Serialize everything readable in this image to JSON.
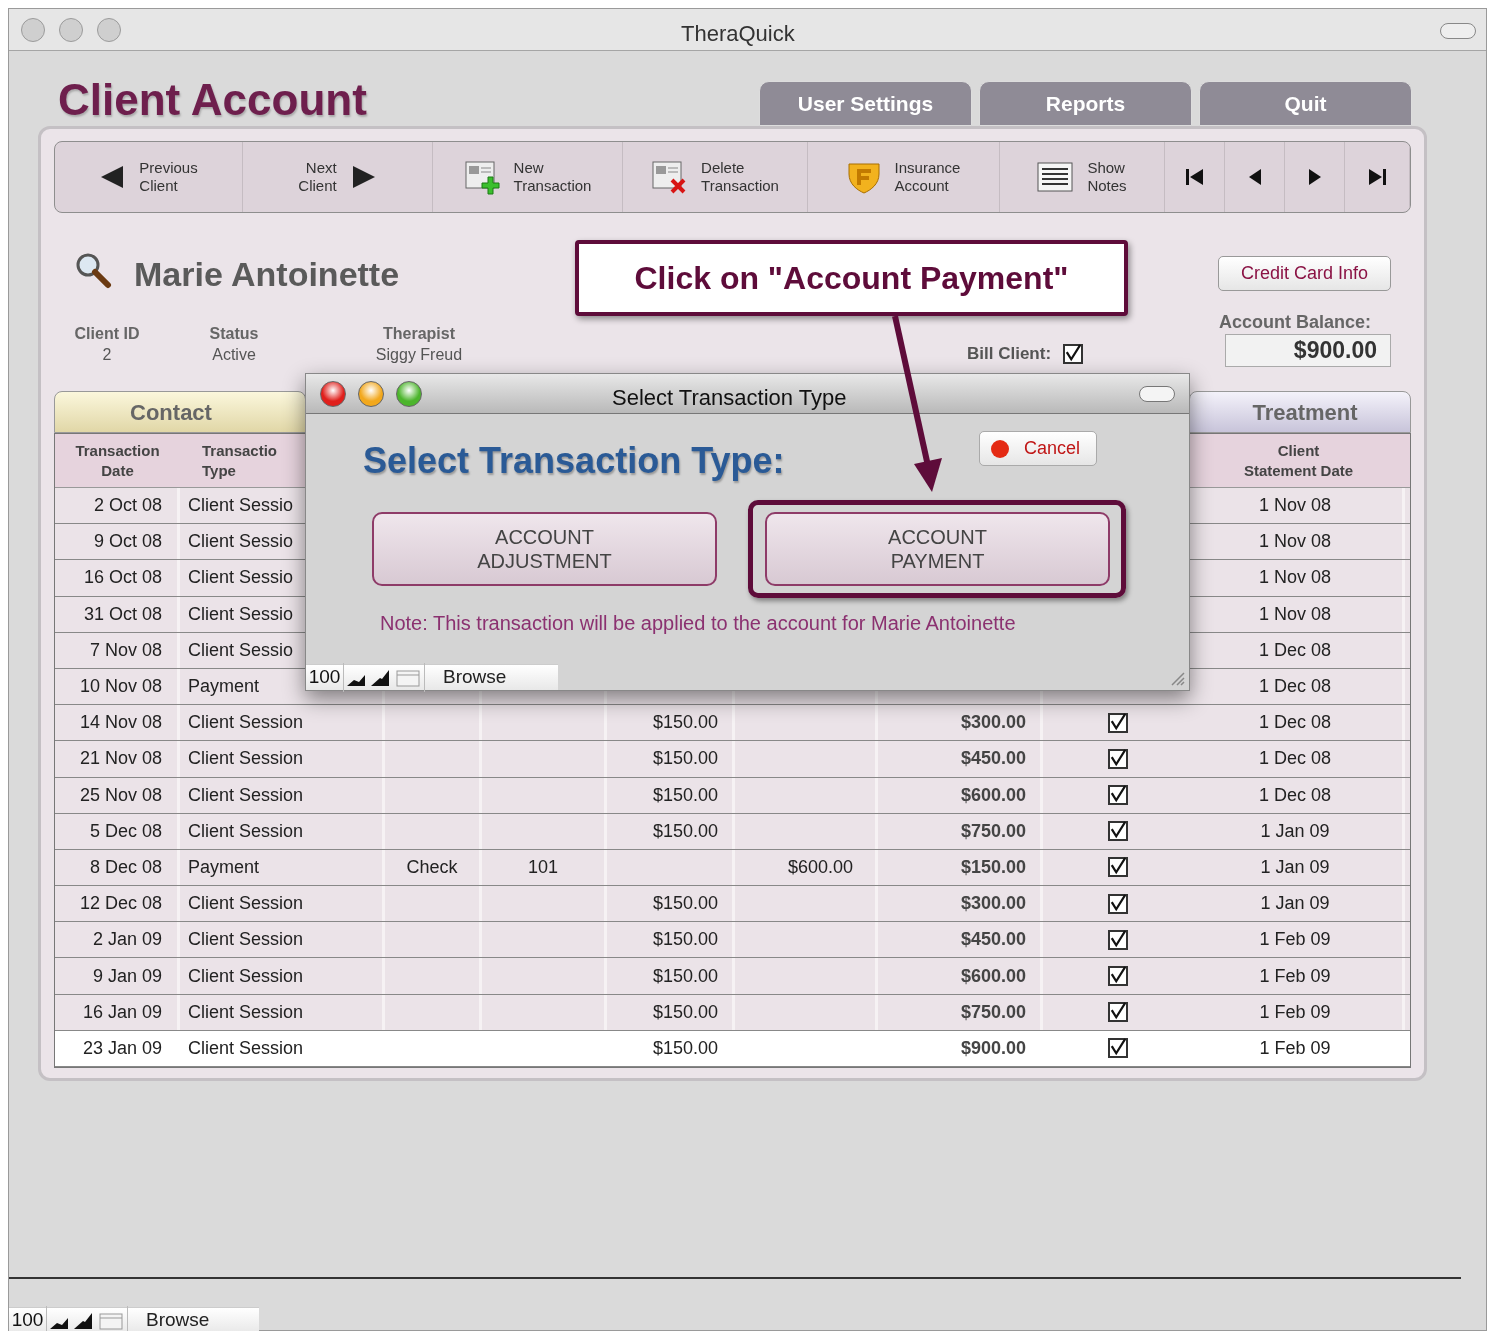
{
  "window": {
    "title": "TheraQuick"
  },
  "page_title": "Client Account",
  "top_tabs": [
    {
      "label": "User Settings"
    },
    {
      "label": "Reports"
    },
    {
      "label": "Quit"
    }
  ],
  "toolbar": [
    {
      "kind": "prev_client",
      "lines": [
        "Previous",
        "Client"
      ]
    },
    {
      "kind": "next_client",
      "lines": [
        "Next",
        "Client"
      ]
    },
    {
      "kind": "new",
      "lines": [
        "New",
        "Transaction"
      ]
    },
    {
      "kind": "delete",
      "lines": [
        "Delete",
        "Transaction"
      ]
    },
    {
      "kind": "insurance",
      "lines": [
        "Insurance",
        "Account"
      ]
    },
    {
      "kind": "notes",
      "lines": [
        "Show",
        "Notes"
      ]
    },
    {
      "kind": "first"
    },
    {
      "kind": "back"
    },
    {
      "kind": "forward"
    },
    {
      "kind": "last"
    }
  ],
  "client": {
    "name": "Marie Antoinette",
    "fields": [
      {
        "label": "Client ID",
        "value": "2"
      },
      {
        "label": "Status",
        "value": "Active"
      },
      {
        "label": "Therapist",
        "value": "Siggy Freud"
      }
    ],
    "bill_client": {
      "label": "Bill Client:",
      "checked": true
    },
    "credit_card_button": "Credit Card Info",
    "balance": {
      "label": "Account Balance:",
      "value": "$900.00"
    }
  },
  "section_tabs": [
    {
      "label": "Contact",
      "kind": "contact"
    },
    {
      "label": "Treatment",
      "kind": "treatment"
    }
  ],
  "table": {
    "header": {
      "date": [
        "Transaction",
        "Date"
      ],
      "type": [
        "Transactio",
        "Type"
      ],
      "statement": [
        "Client",
        "Statement Date"
      ]
    },
    "rows": [
      {
        "date": "2 Oct 08",
        "type": "Client Sessio",
        "statement": "1 Nov 08",
        "selected": false
      },
      {
        "date": "9 Oct 08",
        "type": "Client Sessio",
        "statement": "1 Nov 08",
        "selected": false
      },
      {
        "date": "16 Oct 08",
        "type": "Client Sessio",
        "statement": "1 Nov 08",
        "selected": false
      },
      {
        "date": "31 Oct 08",
        "type": "Client Sessio",
        "statement": "1 Nov 08",
        "selected": false
      },
      {
        "date": "7 Nov 08",
        "type": "Client Sessio",
        "statement": "1 Dec 08",
        "selected": false
      },
      {
        "date": "10 Nov 08",
        "type": "Payment",
        "statement": "1 Dec 08",
        "selected": false
      },
      {
        "date": "14 Nov 08",
        "type": "Client Session",
        "charge": "$150.00",
        "balance": "$300.00",
        "billed": true,
        "statement": "1 Dec 08",
        "selected": false
      },
      {
        "date": "21 Nov 08",
        "type": "Client Session",
        "charge": "$150.00",
        "balance": "$450.00",
        "billed": true,
        "statement": "1 Dec 08",
        "selected": false
      },
      {
        "date": "25 Nov 08",
        "type": "Client Session",
        "charge": "$150.00",
        "balance": "$600.00",
        "billed": true,
        "statement": "1 Dec 08",
        "selected": false
      },
      {
        "date": "5 Dec 08",
        "type": "Client Session",
        "charge": "$150.00",
        "balance": "$750.00",
        "billed": true,
        "statement": "1 Jan 09",
        "selected": false
      },
      {
        "date": "8 Dec 08",
        "type": "Payment",
        "method": "Check",
        "ref": "101",
        "payment": "$600.00",
        "balance": "$150.00",
        "billed": true,
        "statement": "1 Jan 09",
        "selected": false
      },
      {
        "date": "12 Dec 08",
        "type": "Client Session",
        "charge": "$150.00",
        "balance": "$300.00",
        "billed": true,
        "statement": "1 Jan 09",
        "selected": false
      },
      {
        "date": "2 Jan 09",
        "type": "Client Session",
        "charge": "$150.00",
        "balance": "$450.00",
        "billed": true,
        "statement": "1 Feb 09",
        "selected": false
      },
      {
        "date": "9 Jan 09",
        "type": "Client Session",
        "charge": "$150.00",
        "balance": "$600.00",
        "billed": true,
        "statement": "1 Feb 09",
        "selected": false
      },
      {
        "date": "16 Jan 09",
        "type": "Client Session",
        "charge": "$150.00",
        "balance": "$750.00",
        "billed": true,
        "statement": "1 Feb 09",
        "selected": false
      },
      {
        "date": "23 Jan 09",
        "type": "Client Session",
        "charge": "$150.00",
        "balance": "$900.00",
        "billed": true,
        "statement": "1 Feb 09",
        "selected": true
      }
    ]
  },
  "callout": {
    "text": "Click on \"Account Payment\""
  },
  "dialog": {
    "title": "Select Transaction Type",
    "heading": "Select Transaction Type:",
    "cancel": "Cancel",
    "buttons": [
      {
        "lines": [
          "ACCOUNT",
          "ADJUSTMENT"
        ],
        "highlighted": false
      },
      {
        "lines": [
          "ACCOUNT",
          "PAYMENT"
        ],
        "highlighted": true
      }
    ],
    "note": "Note: This transaction will be applied to the account for Marie Antoinette",
    "status_bar": {
      "zoom": "100",
      "mode": "Browse"
    }
  },
  "status_bar": {
    "zoom": "100",
    "mode": "Browse"
  }
}
